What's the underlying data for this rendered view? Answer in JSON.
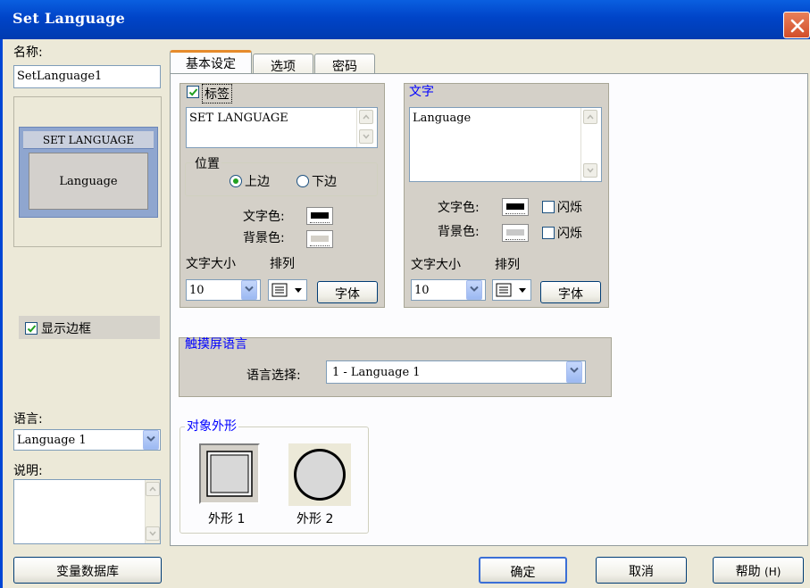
{
  "window": {
    "title": "Set Language"
  },
  "left": {
    "name_label": "名称:",
    "name_value": "SetLanguage1",
    "preview_caption": "SET LANGUAGE",
    "preview_body": "Language",
    "show_border_label": "显示边框",
    "language_label": "语言:",
    "language_value": "Language 1",
    "description_label": "说明:",
    "var_db_button": "变量数据库"
  },
  "tabs": [
    "基本设定",
    "选项",
    "密码"
  ],
  "label_group": {
    "title": "标签",
    "text": "SET LANGUAGE",
    "position_title": "位置",
    "position_top": "上边",
    "position_bottom": "下边",
    "text_color_label": "文字色:",
    "bg_color_label": "背景色:",
    "font_size_label": "文字大小",
    "align_label": "排列",
    "font_size_value": "10",
    "font_button": "字体"
  },
  "text_group": {
    "title": "文字",
    "text": "Language",
    "text_color_label": "文字色:",
    "bg_color_label": "背景色:",
    "blink_label_1": "闪烁",
    "blink_label_2": "闪烁",
    "font_size_label": "文字大小",
    "align_label": "排列",
    "font_size_value": "10",
    "font_button": "字体"
  },
  "touch_group": {
    "title": "触摸屏语言",
    "select_label": "语言选择:",
    "select_value": "1 - Language 1"
  },
  "shape_group": {
    "title": "对象外形",
    "shape1_label": "外形 1",
    "shape2_label": "外形 2"
  },
  "footer": {
    "ok": "确定",
    "cancel": "取消",
    "help": "帮助",
    "help_hotkey": "(H)"
  },
  "colors": {
    "titlebar": "#0054e3",
    "group_title_blue": "#0000ff",
    "dialog_bg": "#ece9d8",
    "tab_accent": "#e68b2c"
  },
  "icons": [
    "close-icon",
    "checkmark-icon",
    "chevron-down-icon",
    "scroll-up-icon",
    "scroll-down-icon",
    "align-icon"
  ]
}
